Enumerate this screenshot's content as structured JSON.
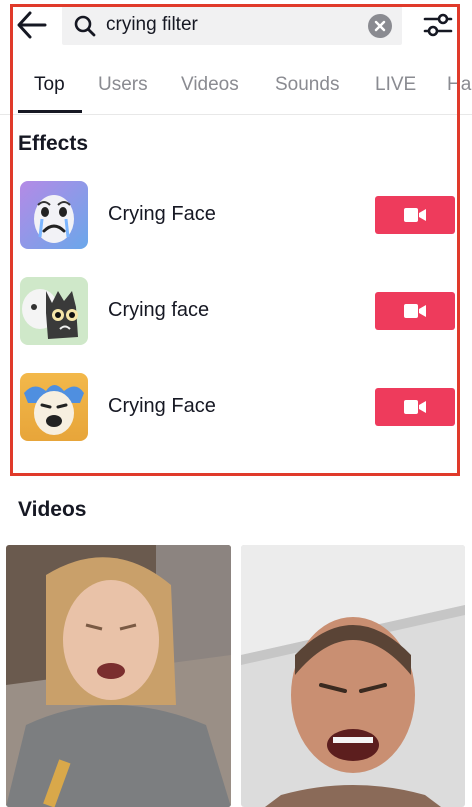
{
  "search": {
    "query": "crying filter"
  },
  "tabs": [
    {
      "label": "Top",
      "active": true
    },
    {
      "label": "Users"
    },
    {
      "label": "Videos"
    },
    {
      "label": "Sounds"
    },
    {
      "label": "LIVE"
    },
    {
      "label": "Ha"
    }
  ],
  "effects": {
    "title": "Effects",
    "items": [
      {
        "name": "Crying Face"
      },
      {
        "name": "Crying face"
      },
      {
        "name": "Crying Face"
      }
    ]
  },
  "videos": {
    "title": "Videos"
  },
  "colors": {
    "accent": "#ee3b5c",
    "highlight_border": "#e03a2a",
    "muted_text": "#8a8b91"
  }
}
